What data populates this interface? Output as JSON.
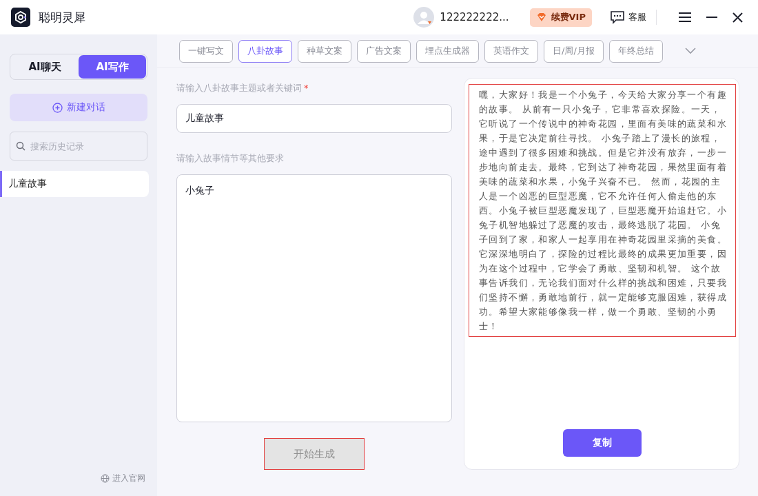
{
  "app": {
    "title": "聪明灵犀"
  },
  "header": {
    "username": "122222222...",
    "vip_label": "续费VIP",
    "support_label": "客服"
  },
  "sidebar": {
    "mode_tabs": [
      {
        "label": "AI聊天",
        "selected": false
      },
      {
        "label": "AI写作",
        "selected": true
      }
    ],
    "new_chat_label": "新建对话",
    "search": {
      "placeholder": "搜索历史记录"
    },
    "history": [
      {
        "label": "儿童故事",
        "selected": true
      }
    ],
    "footer_link": "进入官网"
  },
  "category_tabs": [
    {
      "label": "一键写文",
      "selected": false
    },
    {
      "label": "八卦故事",
      "selected": true
    },
    {
      "label": "种草文案",
      "selected": false
    },
    {
      "label": "广告文案",
      "selected": false
    },
    {
      "label": "埋点生成器",
      "selected": false
    },
    {
      "label": "英语作文",
      "selected": false
    },
    {
      "label": "日/周/月报",
      "selected": false
    },
    {
      "label": "年终总结",
      "selected": false
    }
  ],
  "form": {
    "topic_label": "请输入八卦故事主题或者关键词",
    "topic_required": true,
    "topic_required_mark": "*",
    "topic_value": "儿童故事",
    "details_label": "请输入故事情节等其他要求",
    "details_value": "小兔子",
    "generate_button": {
      "label": "开始生成",
      "disabled": true
    }
  },
  "output": {
    "text": "嘿，大家好！我是一个小兔子，今天给大家分享一个有趣的故事。 从前有一只小兔子，它非常喜欢探险。一天，它听说了一个传说中的神奇花园，里面有美味的蔬菜和水果，于是它决定前往寻找。 小兔子踏上了漫长的旅程，途中遇到了很多困难和挑战。但是它并没有放弃，一步一步地向前走去。最终，它到达了神奇花园，果然里面有着美味的蔬菜和水果，小兔子兴奋不已。 然而，花园的主人是一个凶恶的巨型恶魔，它不允许任何人偷走他的东西。小兔子被巨型恶魔发现了，巨型恶魔开始追赶它。小兔子机智地躲过了恶魔的攻击，最终逃脱了花园。 小兔子回到了家，和家人一起享用在神奇花园里采摘的美食。它深深地明白了，探险的过程比最终的成果更加重要，因为在这个过程中，它学会了勇敢、坚韧和机智。 这个故事告诉我们，无论我们面对什么样的挑战和困难，只要我们坚持不懈，勇敢地前行，就一定能够克服困难，获得成功。希望大家能够像我一样，做一个勇敢、坚韧的小勇士！",
    "copy_label": "复制"
  }
}
